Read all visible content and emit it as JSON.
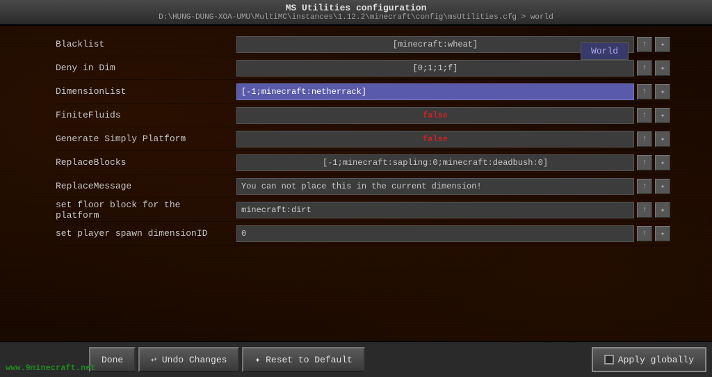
{
  "titleBar": {
    "title": "MS Utilities configuration",
    "path": "D:\\HUNG-DUNG-XOA-UMU\\MultiMC\\instances\\1.12.2\\minecraft\\config\\msUtilities.cfg > world"
  },
  "worldTab": "World",
  "rows": [
    {
      "label": "Blacklist",
      "value": "[minecraft:wheat]",
      "type": "normal"
    },
    {
      "label": "Deny in Dim",
      "value": "[0;1;1;f]",
      "type": "normal"
    },
    {
      "label": "DimensionList",
      "value": "[-1;minecraft:netherrack]",
      "type": "highlighted"
    },
    {
      "label": "FiniteFluids",
      "value": "false",
      "type": "false-val"
    },
    {
      "label": "Generate Simply Platform",
      "value": "false",
      "type": "false-val"
    },
    {
      "label": "ReplaceBlocks",
      "value": "[-1;minecraft:sapling:0;minecraft:deadbush:0]",
      "type": "normal"
    },
    {
      "label": "ReplaceMessage",
      "value": "You can not place this in the current dimension!",
      "type": "text-left"
    },
    {
      "label": "set floor block for the platform",
      "value": "minecraft:dirt",
      "type": "text-left"
    },
    {
      "label": "set player spawn dimensionID",
      "value": "0",
      "type": "text-left"
    }
  ],
  "footer": {
    "done_label": "Done",
    "undo_label": "↩ Undo Changes",
    "reset_label": "✦ Reset to Default",
    "apply_label": "Apply globally",
    "watermark": "www.9minecraft.net"
  },
  "icons": {
    "arrow_up": "↑",
    "reset_small": "✦"
  }
}
